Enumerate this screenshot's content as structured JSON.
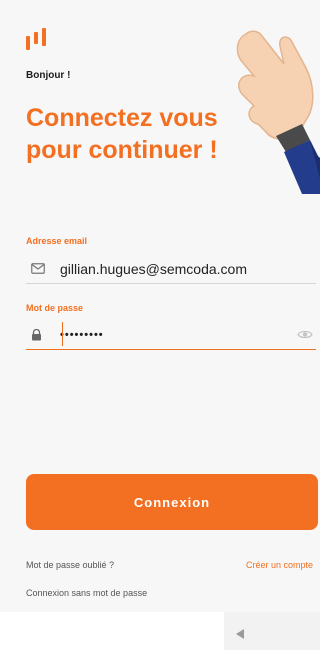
{
  "header": {
    "greeting": "Bonjour !",
    "headline": "Connectez vous pour continuer !"
  },
  "form": {
    "email_label": "Adresse email",
    "email_value": "gillian.hugues@semcoda.com",
    "password_label": "Mot de passe",
    "password_value": "•••••••••"
  },
  "actions": {
    "login_label": "Connexion",
    "forgot_label": "Mot de passe oublié ?",
    "create_label": "Créer un compte",
    "passwordless_label": "Connexion sans mot de passe"
  },
  "colors": {
    "accent": "#f36f21",
    "background": "#f7f7f7",
    "text": "#1d1d1d"
  },
  "icons": {
    "logo": "brand-logo-icon",
    "email": "envelope-icon",
    "password": "lock-icon",
    "visibility": "eye-icon",
    "waving_hand": "waving-hand-icon",
    "nav_back": "back-triangle-icon"
  }
}
